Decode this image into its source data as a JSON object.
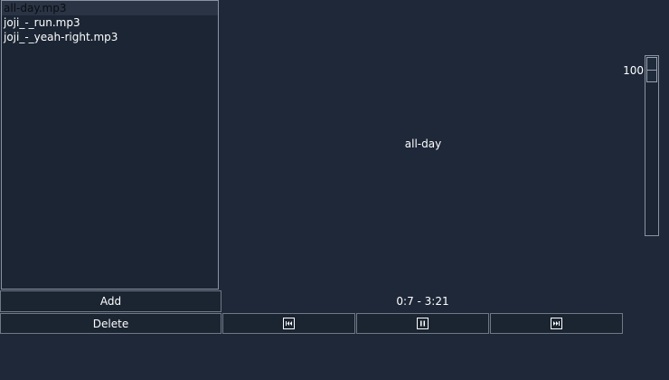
{
  "playlist": {
    "items": [
      {
        "label": "all-day.mp3",
        "selected": true
      },
      {
        "label": "joji_-_run.mp3",
        "selected": false
      },
      {
        "label": "joji_-_yeah-right.mp3",
        "selected": false
      }
    ]
  },
  "buttons": {
    "add_label": "Add",
    "delete_label": "Delete"
  },
  "player": {
    "now_playing": "all-day",
    "time": "0:7 - 3:21",
    "icons": {
      "previous": "skip-previous-icon",
      "pause": "pause-icon",
      "next": "skip-next-icon"
    }
  },
  "volume": {
    "value": "100",
    "level_fraction": 1.0
  }
}
